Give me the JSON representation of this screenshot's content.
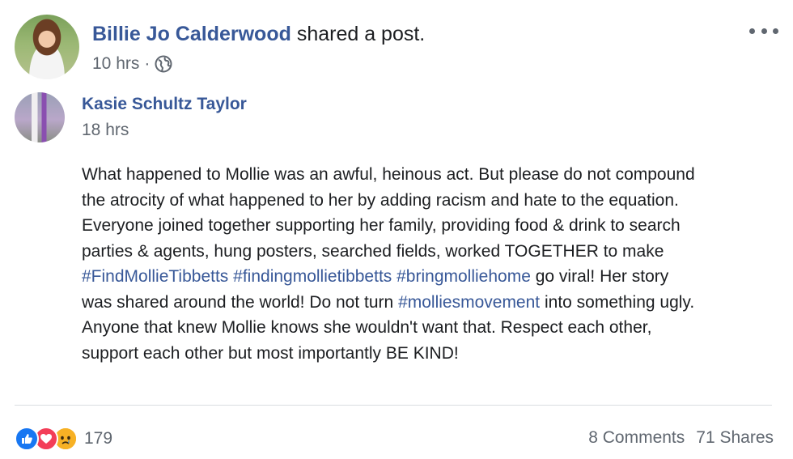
{
  "post": {
    "author": "Billie Jo Calderwood",
    "action": " shared a post.",
    "time": "10 hrs",
    "privacy_icon": "globe-icon"
  },
  "shared": {
    "author": "Kasie Schultz Taylor",
    "time": "18 hrs",
    "lines": [
      [
        {
          "t": "What happened to Mollie was an awful, heinous act. But please do not compound"
        }
      ],
      [
        {
          "t": "the atrocity of what happened to her by adding racism and hate to the equation."
        }
      ],
      [
        {
          "t": "Everyone joined together supporting her family, providing food & drink to search"
        }
      ],
      [
        {
          "t": "parties & agents, hung posters, searched fields, worked TOGETHER to make"
        }
      ],
      [
        {
          "t": "#FindMollieTibbetts",
          "h": true
        },
        {
          "t": " "
        },
        {
          "t": "#findingmollietibbetts",
          "h": true
        },
        {
          "t": " "
        },
        {
          "t": "#bringmolliehome",
          "h": true
        },
        {
          "t": " go viral! Her story"
        }
      ],
      [
        {
          "t": "was shared around the world! Do not turn "
        },
        {
          "t": "#molliesmovement",
          "h": true
        },
        {
          "t": " into something ugly."
        }
      ],
      [
        {
          "t": "Anyone that knew Mollie knows she wouldn't want that. Respect each other,"
        }
      ],
      [
        {
          "t": "support each other but most importantly BE KIND!"
        }
      ]
    ]
  },
  "footer": {
    "reaction_icons": [
      "like-icon",
      "love-icon",
      "sad-icon"
    ],
    "reaction_count": "179",
    "comments": "8 Comments",
    "shares": "71 Shares"
  },
  "colors": {
    "link": "#385898",
    "text": "#1c1e21",
    "meta": "#606770",
    "divider": "#dadde1"
  }
}
